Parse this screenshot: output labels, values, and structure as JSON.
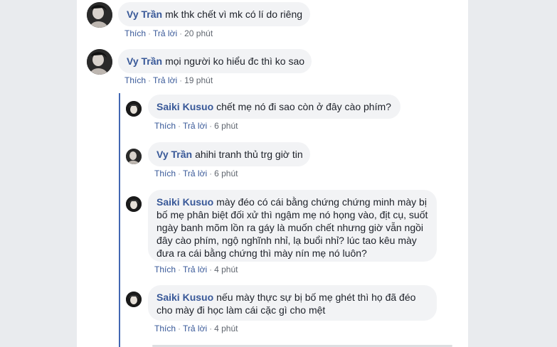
{
  "comments": [
    {
      "author": "Vy Trần",
      "text": "mk thk chết vì mk có lí do riêng",
      "like": "Thích",
      "reply": "Trả lời",
      "time": "20 phút"
    },
    {
      "author": "Vy Trần",
      "text": "mọi người ko hiểu đc thì ko sao",
      "like": "Thích",
      "reply": "Trả lời",
      "time": "19 phút"
    }
  ],
  "replies": [
    {
      "author": "Saiki Kusuo",
      "text": "chết mẹ nó đi sao còn ở đây cào phím?",
      "like": "Thích",
      "reply": "Trả lời",
      "time": "6 phút"
    },
    {
      "author": "Vy Trần",
      "text": "ahihi tranh thủ trg giờ tin",
      "like": "Thích",
      "reply": "Trả lời",
      "time": "6 phút"
    },
    {
      "author": "Saiki Kusuo",
      "text": "mày đéo có cái bằng chứng chứng minh mày bị bố mẹ phân biệt đối xử thì ngậm mẹ nó họng vào, địt cụ, suốt ngày banh mõm lồn ra gáy là muốn chết nhưng giờ vẫn ngồi đây cào phím, ngộ nghĩnh nhỉ, lạ buổi nhỉ? lúc tao kêu mày đưa ra cái bằng chứng thì mày nín mẹ nó luôn?",
      "like": "Thích",
      "reply": "Trả lời",
      "time": "4 phút"
    },
    {
      "author": "Saiki Kusuo",
      "text": "nếu mày thực sự bị bố mẹ ghét thì họ đã đéo cho mày đi học làm cái cặc gì cho mệt",
      "like": "Thích",
      "reply": "Trả lời",
      "time": "4 phút"
    }
  ],
  "colors": {
    "author": "#385898",
    "bubble": "#f2f3f5",
    "thread_line": "#4267b2"
  }
}
